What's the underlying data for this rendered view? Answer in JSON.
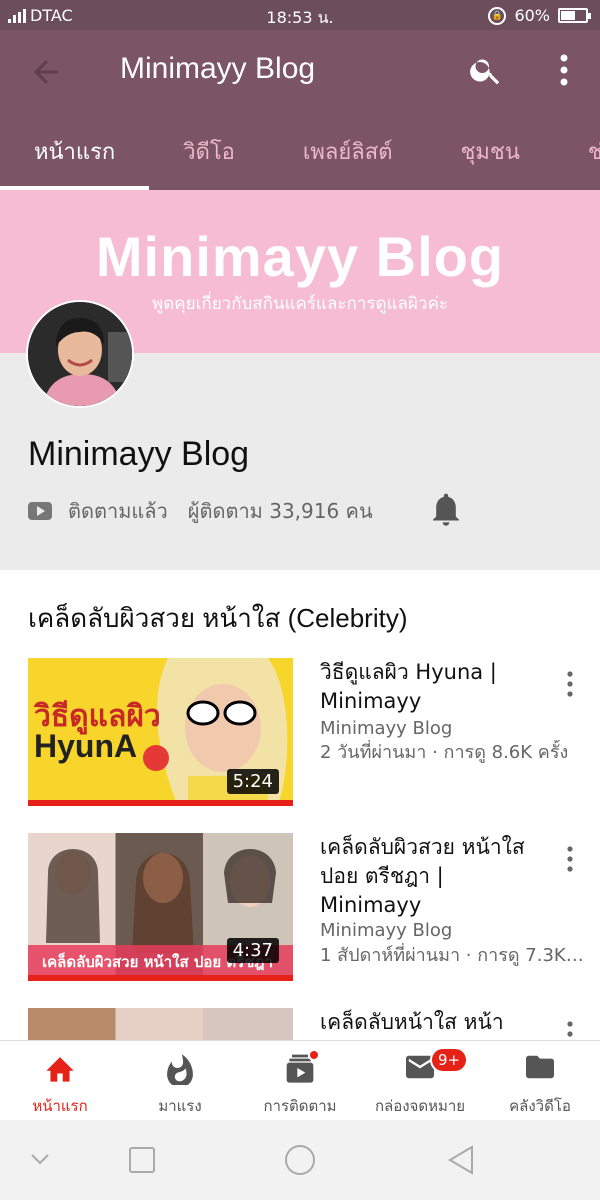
{
  "status_bar": {
    "carrier": "DTAC",
    "time": "18:53 น.",
    "battery": "60%",
    "battery_level": 0.6
  },
  "app_bar": {
    "title": "Minimayy Blog",
    "back_icon": "arrow-back-icon",
    "search_icon": "search-icon",
    "more_icon": "more-vert-icon"
  },
  "tabs": [
    {
      "label": "หน้าแรก",
      "active": true
    },
    {
      "label": "วิดีโอ"
    },
    {
      "label": "เพลย์ลิสต์"
    },
    {
      "label": "ชุมชน"
    },
    {
      "label": "ช่"
    }
  ],
  "banner": {
    "title": "Minimayy Blog",
    "subtitle": "พูดคุยเกี่ยวกับสกินแคร์และการดูแลผิวค่ะ"
  },
  "channel": {
    "name": "Minimayy Blog",
    "subscribed_label": "ติดตามแล้ว",
    "subscribers": "ผู้ติดตาม 33,916 คน"
  },
  "section": {
    "title": "เคล็ดลับผิวสวย หน้าใส (Celebrity)"
  },
  "videos": [
    {
      "title": "วิธีดูแลผิว Hyuna | Minimayy",
      "channel": "Minimayy Blog",
      "meta": "2 วันที่ผ่านมา · การดู 8.6K ครั้ง",
      "duration": "5:24",
      "thumb_text1": "วิธีดูแลผิว",
      "thumb_text2": "HyunA",
      "watched": 1.0
    },
    {
      "title": "เคล็ดลับผิวสวย หน้าใส ปอย ตรีชฎา | Minimayy",
      "channel": "Minimayy Blog",
      "meta": "1 สัปดาห์ที่ผ่านมา · การดู 7.3K…",
      "duration": "4:37",
      "thumb_caption": "เคล็ดลับผิวสวย หน้าใส ปอย ตรีชฎา",
      "watched": 1.0
    },
    {
      "title": "เคล็ดลับหน้าใส หน้า"
    }
  ],
  "bottom_nav": [
    {
      "label": "หน้าแรก",
      "icon": "home-icon",
      "active": true
    },
    {
      "label": "มาแรง",
      "icon": "trending-icon"
    },
    {
      "label": "การติดตาม",
      "icon": "subscriptions-icon",
      "dot": true
    },
    {
      "label": "กล่องจดหมาย",
      "icon": "inbox-icon",
      "badge": "9+"
    },
    {
      "label": "คลังวิดีโอ",
      "icon": "library-icon"
    }
  ],
  "colors": {
    "header": "#7b5563",
    "banner": "#f6bcd1",
    "accent": "#e62117"
  }
}
